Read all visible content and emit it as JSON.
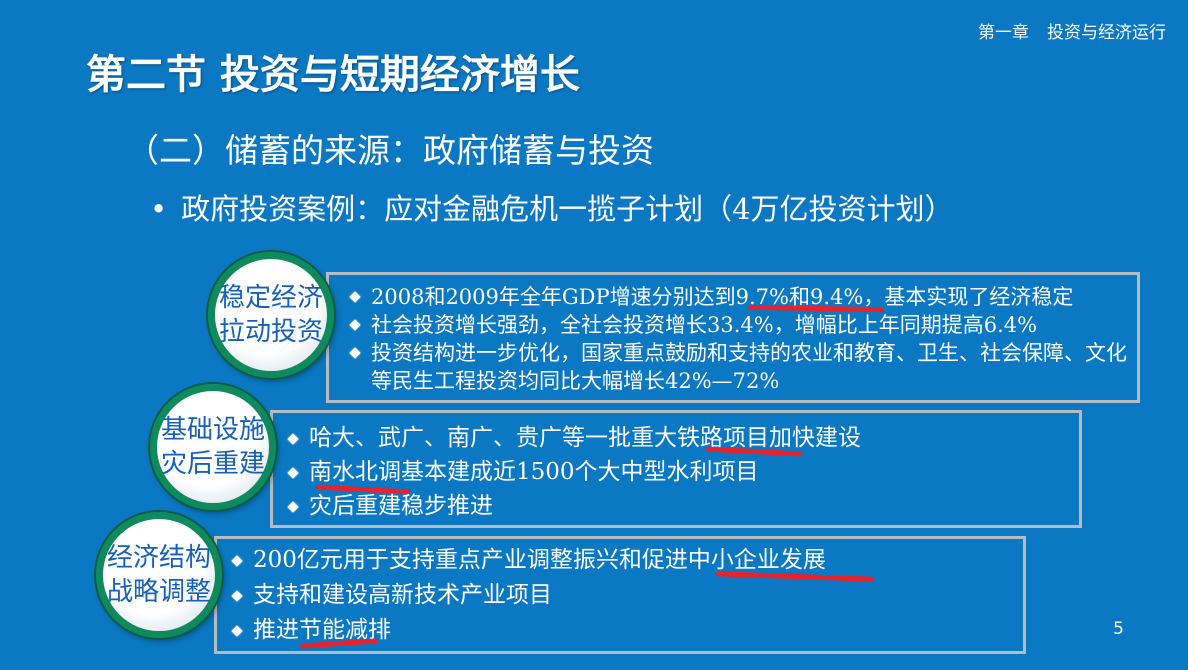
{
  "header": {
    "chapter": "第一章",
    "chapter_title": "投资与经济运行"
  },
  "section_title": "第二节  投资与短期经济增长",
  "subsection_title": "（二）储蓄的来源：政府储蓄与投资",
  "bullet": {
    "dot": "•",
    "text": "政府投资案例：应对金融危机一揽子计划（4万亿投资计划）"
  },
  "groups": [
    {
      "label_line1": "稳定经济",
      "label_line2": "拉动投资",
      "items": [
        "2008和2009年全年GDP增速分别达到9.7%和9.4%，基本实现了经济稳定",
        "社会投资增长强劲，全社会投资增长33.4%，增幅比上年同期提高6.4%",
        "投资结构进一步优化，国家重点鼓励和支持的农业和教育、卫生、社会保障、文化等民生工程投资均同比大幅增长42%—72%"
      ]
    },
    {
      "label_line1": "基础设施",
      "label_line2": "灾后重建",
      "items": [
        "哈大、武广、南广、贵广等一批重大铁路项目加快建设",
        "南水北调基本建成近1500个大中型水利项目",
        "灾后重建稳步推进"
      ]
    },
    {
      "label_line1": "经济结构",
      "label_line2": "战略调整",
      "items": [
        "200亿元用于支持重点产业调整振兴和促进中小企业发展",
        "支持和建设高新技术产业项目",
        "推进节能减排"
      ]
    }
  ],
  "page_number": "5",
  "colors": {
    "background": "#0a78c2",
    "circle_ring": "#0e8a5c",
    "circle_text": "#1560b8",
    "box_border": "#b5bcc4",
    "underline_mark": "#e8212a"
  }
}
